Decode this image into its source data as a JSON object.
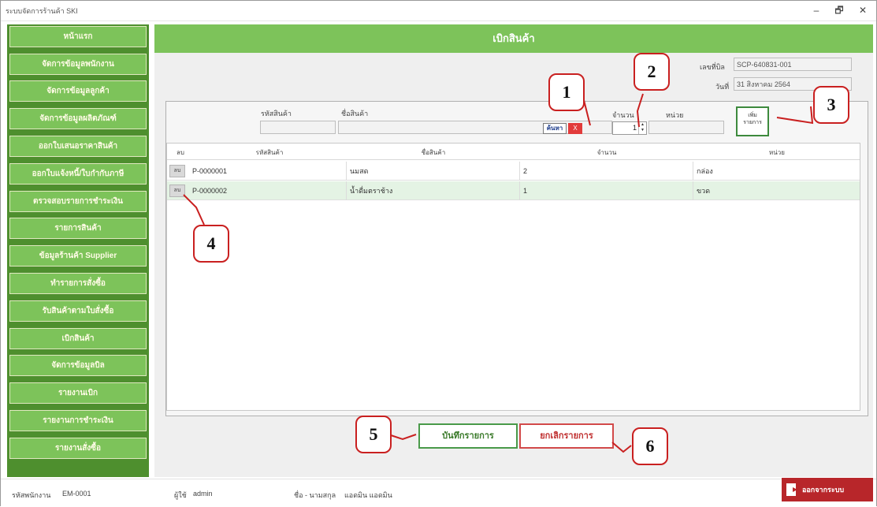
{
  "window": {
    "title": "ระบบจัดการร้านค้า SKI",
    "minimize": "–",
    "maximize": "🗗",
    "close": "✕"
  },
  "sidebar": {
    "items": [
      {
        "label": "หน้าแรก"
      },
      {
        "label": "จัดการข้อมูลพนักงาน"
      },
      {
        "label": "จัดการข้อมูลลูกค้า"
      },
      {
        "label": "จัดการข้อมูลผลิตภัณฑ์"
      },
      {
        "label": "ออกใบเสนอราคาสินค้า"
      },
      {
        "label": "ออกใบแจ้งหนี้/ใบกำกับภาษี"
      },
      {
        "label": "ตรวจสอบรายการชำระเงิน"
      },
      {
        "label": "รายการสินค้า"
      },
      {
        "label": "ข้อมูลร้านค้า Supplier"
      },
      {
        "label": "ทำรายการสั่งซื้อ"
      },
      {
        "label": "รับสินค้าตามใบสั่งซื้อ"
      },
      {
        "label": "เบิกสินค้า"
      },
      {
        "label": "จัดการข้อมูลบิล"
      },
      {
        "label": "รายงานเบิก"
      },
      {
        "label": "รายงานการชำระเงิน"
      },
      {
        "label": "รายงานสั่งซื้อ"
      }
    ]
  },
  "main": {
    "banner": "เบิกสินค้า",
    "doc_no_label": "เลขที่บิล",
    "doc_no_value": "SCP-640831-001",
    "date_label": "วันที่",
    "date_value": "31 สิงหาคม 2564",
    "product_code_label": "รหัสสินค้า",
    "product_name_label": "ชื่อสินค้า",
    "search_button": "ค้นหา",
    "search_badge": "X",
    "quantity_label": "จำนวน",
    "quantity_value": "1",
    "unit_label": "หน่วย",
    "add_button_line1": "เพิ่ม",
    "add_button_line2": "รายการ",
    "grid": {
      "columns": [
        "ลบ",
        "รหัสสินค้า",
        "ชื่อสินค้า",
        "จำนวน",
        "หน่วย"
      ],
      "rows": [
        {
          "action": "ลบ",
          "code": "P-0000001",
          "name": "นมสด",
          "qty": "2",
          "unit": "กล่อง"
        },
        {
          "action": "ลบ",
          "code": "P-0000002",
          "name": "น้ำดื่มตราช้าง",
          "qty": "1",
          "unit": "ขวด"
        }
      ]
    },
    "save_button": "บันทึกรายการ",
    "cancel_button": "ยกเลิกรายการ"
  },
  "statusbar": {
    "employee_label": "รหัสพนักงาน",
    "employee_value": "EM-0001",
    "user_label": "ผู้ใช้",
    "user_value": "admin",
    "name_label": "ชื่อ - นามสกุล",
    "name_value": "แอดมิน แอดมิน",
    "logout": "ออกจากระบบ"
  },
  "callouts": [
    "1",
    "2",
    "3",
    "4",
    "5",
    "6"
  ],
  "colors": {
    "sidebar_bg": "#4e8f2e",
    "menu_item": "#7dc35a",
    "banner": "#7dc35a",
    "callout_border": "#c92020",
    "logout": "#b8262a",
    "selected_row": "#e4f3e4"
  }
}
